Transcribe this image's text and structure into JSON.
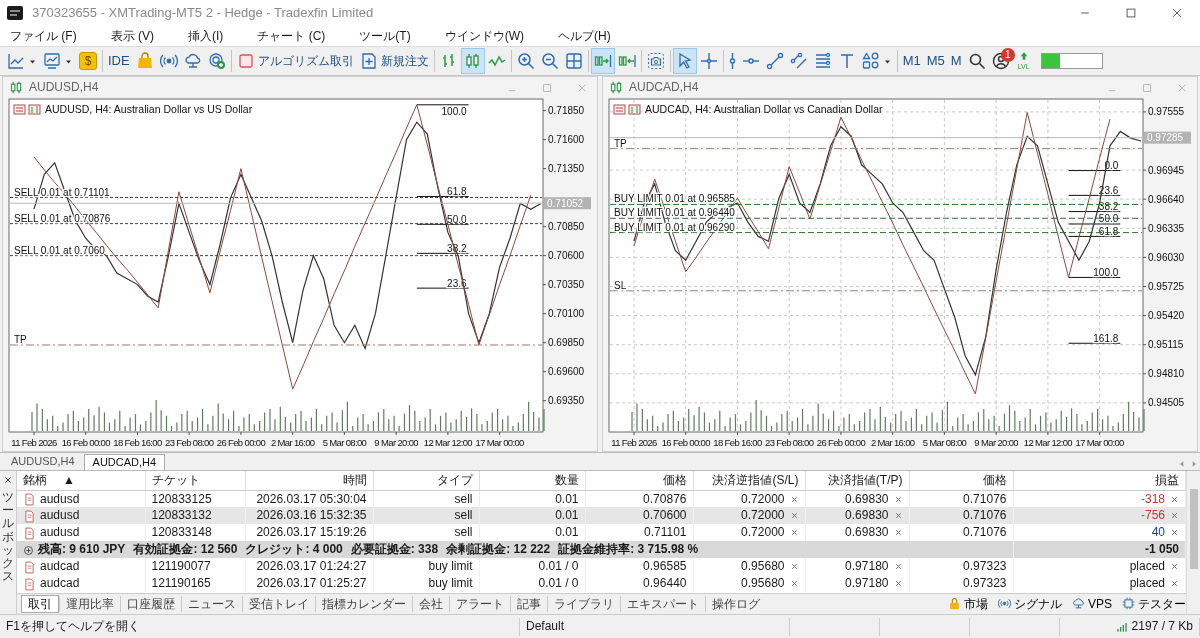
{
  "window": {
    "title": "370323655 - XMTrading-MT5 2 - Hedge - Tradexfin Limited"
  },
  "menu": [
    "ファイル (F)",
    "表示 (V)",
    "挿入(I)",
    "チャート (C)",
    "ツール(T)",
    "ウインドウ(W)",
    "ヘルプ(H)"
  ],
  "toolbar": [
    {
      "kind": "icon",
      "selected": false,
      "dropdown": true
    },
    {
      "kind": "icon",
      "selected": false,
      "dropdown": true
    },
    {
      "kind": "coin",
      "label": "$",
      "selected": false
    },
    {
      "kind": "separator"
    },
    {
      "kind": "text",
      "label": "IDE",
      "selected": false
    },
    {
      "kind": "icon",
      "selected": false
    },
    {
      "kind": "icon",
      "selected": false
    },
    {
      "kind": "icon",
      "selected": false
    },
    {
      "kind": "icon",
      "selected": false
    },
    {
      "kind": "separator"
    },
    {
      "kind": "label",
      "label": "アルゴリズム取引",
      "selected": false
    },
    {
      "kind": "label",
      "label": "新規注文",
      "selected": false
    },
    {
      "kind": "separator"
    },
    {
      "kind": "icon",
      "selected": false
    },
    {
      "kind": "icon",
      "selected": true
    },
    {
      "kind": "icon",
      "selected": false
    },
    {
      "kind": "separator"
    },
    {
      "kind": "icon",
      "selected": false
    },
    {
      "kind": "icon",
      "selected": false
    },
    {
      "kind": "icon",
      "selected": false
    },
    {
      "kind": "separator"
    },
    {
      "kind": "icon",
      "selected": true
    },
    {
      "kind": "icon",
      "selected": false
    },
    {
      "kind": "separator"
    },
    {
      "kind": "icon",
      "selected": false
    },
    {
      "kind": "separator"
    },
    {
      "kind": "icon",
      "selected": true
    },
    {
      "kind": "icon",
      "selected": false
    },
    {
      "kind": "separator"
    },
    {
      "kind": "icon",
      "selected": false
    },
    {
      "kind": "icon",
      "selected": false
    },
    {
      "kind": "icon",
      "selected": false
    },
    {
      "kind": "icon",
      "selected": false
    },
    {
      "kind": "icon",
      "selected": false
    },
    {
      "kind": "icon",
      "selected": false
    },
    {
      "kind": "icon",
      "selected": false,
      "dropdown": true
    },
    {
      "kind": "separator"
    },
    {
      "kind": "text",
      "label": "M1",
      "selected": false
    },
    {
      "kind": "text",
      "label": "M5",
      "selected": false
    },
    {
      "kind": "text",
      "label": "M",
      "selected": false
    },
    {
      "kind": "icon",
      "selected": false
    },
    {
      "kind": "account",
      "badge": "1",
      "selected": false
    },
    {
      "kind": "lvl",
      "label": "LVL",
      "selected": false
    },
    {
      "kind": "meter",
      "level": 0.3
    }
  ],
  "charts": [
    {
      "window_title": "AUDUSD,H4",
      "header": "AUDUSD, H4:  Australian Dollar vs US Dollar",
      "fibonacci_levels": [
        "100.0",
        "61.8",
        "50.0",
        "38.2",
        "23.6"
      ],
      "chart_data": {
        "type": "line",
        "grid": false,
        "ylim": [
          0.6908,
          0.7195
        ],
        "categories": [
          "11 Feb 2026",
          null,
          null,
          null,
          null,
          "16 Feb 00:00",
          null,
          null,
          null,
          null,
          "18 Feb 16:00",
          null,
          null,
          null,
          null,
          "23 Feb 08:00",
          null,
          null,
          null,
          null,
          "26 Feb 00:00",
          null,
          null,
          null,
          null,
          "2 Mar 16:00",
          null,
          null,
          null,
          null,
          "5 Mar 08:00",
          null,
          null,
          null,
          null,
          "9 Mar 20:00",
          null,
          null,
          null,
          null,
          "12 Mar 12:00",
          null,
          null,
          null,
          null,
          "17 Mar 00:00",
          null,
          null,
          null,
          null
        ],
        "series": [
          {
            "color": "#333333",
            "values": [
              0.71,
              0.713,
              0.714,
              0.7115,
              0.709,
              0.7075,
              0.7065,
              0.706,
              0.7045,
              0.704,
              0.7035,
              0.7025,
              0.702,
              0.706,
              0.7105,
              0.708,
              0.7055,
              0.7035,
              0.707,
              0.711,
              0.713,
              0.711,
              0.709,
              0.706,
              0.702,
              0.6985,
              0.703,
              0.706,
              0.704,
              0.7,
              0.6985,
              0.7,
              0.698,
              0.701,
              0.706,
              0.711,
              0.716,
              0.7175,
              0.7165,
              0.712,
              0.708,
              0.706,
              0.701,
              0.6985,
              0.701,
              0.705,
              0.7075,
              0.7105,
              0.71,
              0.7105
            ]
          },
          {
            "color": "#8b4a3c",
            "values": [
              0.7145,
              0.7134,
              0.7123,
              0.7113,
              0.7102,
              0.7091,
              0.708,
              0.7069,
              0.7058,
              0.7048,
              0.7037,
              0.7026,
              0.7015,
              0.7065,
              0.7115,
              0.7086,
              0.7057,
              0.7028,
              0.7064,
              0.7099,
              0.7135,
              0.7097,
              0.7059,
              0.7021,
              0.6983,
              0.6945,
              0.6965,
              0.6986,
              0.7006,
              0.7027,
              0.7047,
              0.7068,
              0.7088,
              0.7108,
              0.7129,
              0.7149,
              0.717,
              0.719,
              0.7156,
              0.7121,
              0.7087,
              0.7052,
              0.7018,
              0.6983,
              0.7009,
              0.7035,
              0.706,
              0.7086,
              0.7112,
              null
            ]
          }
        ],
        "yticks": [
          {
            "value": 0.7185,
            "label": "0.71850"
          },
          {
            "value": 0.716,
            "label": "0.71600"
          },
          {
            "value": 0.7135,
            "label": "0.71350"
          },
          {
            "value": 0.7085,
            "label": "0.70850"
          },
          {
            "value": 0.706,
            "label": "0.70600"
          },
          {
            "value": 0.7035,
            "label": "0.70350"
          },
          {
            "value": 0.701,
            "label": "0.70100"
          },
          {
            "value": 0.6985,
            "label": "0.69850"
          },
          {
            "value": 0.696,
            "label": "0.69600"
          },
          {
            "value": 0.6935,
            "label": "0.69350"
          }
        ],
        "ref_lines": [
          {
            "axis": "y",
            "value": 0.71101,
            "label": "SELL 0.01 at 0.71101",
            "color": "#444444"
          },
          {
            "axis": "y",
            "value": 0.70876,
            "label": "SELL 0.01 at 0.70876",
            "color": "#444444"
          },
          {
            "axis": "y",
            "value": 0.706,
            "label": "SELL 0.01 at 0.7060",
            "color": "#444444"
          },
          {
            "axis": "y",
            "value": 0.6983,
            "label": "TP",
            "color": "#a57a68"
          },
          {
            "axis": "y",
            "value": 0.71052,
            "label": "0.71052",
            "color": "#b8b8b8"
          }
        ]
      }
    },
    {
      "window_title": "AUDCAD,H4",
      "header": "AUDCAD, H4:  Australian Dollar vs Canadian Dollar",
      "fibonacci_levels": [
        "0.0",
        "23.6",
        "38.2",
        "50.0",
        "61.8",
        "100.0",
        "161.8"
      ],
      "chart_data": {
        "type": "line",
        "grid": true,
        "ylim": [
          0.942,
          0.9769
        ],
        "categories": [
          "11 Feb 2026",
          null,
          null,
          null,
          null,
          "16 Feb 00:00",
          null,
          null,
          null,
          null,
          "18 Feb 16:00",
          null,
          null,
          null,
          null,
          "23 Feb 08:00",
          null,
          null,
          null,
          null,
          "26 Feb 00:00",
          null,
          null,
          null,
          null,
          "2 Mar 16:00",
          null,
          null,
          null,
          null,
          "5 Mar 08:00",
          null,
          null,
          null,
          null,
          "9 Mar 20:00",
          null,
          null,
          null,
          null,
          "12 Mar 12:00",
          null,
          null,
          null,
          null,
          "17 Mar 00:00",
          null,
          null,
          null,
          null
        ],
        "series": [
          {
            "color": "#333333",
            "values": [
              0.962,
              0.966,
              0.968,
              0.964,
              0.961,
              0.96,
              0.962,
              0.964,
              0.965,
              0.9655,
              0.966,
              0.964,
              0.9625,
              0.962,
              0.9665,
              0.969,
              0.966,
              0.965,
              0.968,
              0.972,
              0.974,
              0.973,
              0.97,
              0.969,
              0.968,
              0.966,
              0.965,
              0.963,
              0.961,
              0.96,
              0.957,
              0.954,
              0.95,
              0.948,
              0.952,
              0.959,
              0.965,
              0.97,
              0.973,
              0.972,
              0.968,
              0.964,
              0.962,
              0.96,
              0.962,
              0.966,
              0.972,
              0.9735,
              0.9728,
              0.9725
            ]
          },
          {
            "color": "#8b4a3c",
            "values": [
              0.9615,
              0.965,
              0.9685,
              0.9653,
              0.962,
              0.9588,
              0.9603,
              0.9619,
              0.9634,
              0.965,
              0.9665,
              0.9647,
              0.963,
              0.9612,
              0.9655,
              0.9698,
              0.9671,
              0.9643,
              0.9679,
              0.9714,
              0.975,
              0.9728,
              0.9705,
              0.9683,
              0.9661,
              0.9639,
              0.9616,
              0.9594,
              0.9572,
              0.9549,
              0.9527,
              0.9505,
              0.9482,
              0.946,
              0.9519,
              0.9578,
              0.9637,
              0.9696,
              0.9755,
              0.9712,
              0.9669,
              0.9625,
              0.9582,
              0.9624,
              0.9665,
              0.9707,
              0.9748,
              null,
              null,
              null
            ]
          }
        ],
        "yticks": [
          {
            "value": 0.97555,
            "label": "0.97555"
          },
          {
            "value": 0.96945,
            "label": "0.96945"
          },
          {
            "value": 0.9664,
            "label": "0.96640"
          },
          {
            "value": 0.96335,
            "label": "0.96335"
          },
          {
            "value": 0.9603,
            "label": "0.96030"
          },
          {
            "value": 0.95725,
            "label": "0.95725"
          },
          {
            "value": 0.9542,
            "label": "0.95420"
          },
          {
            "value": 0.95115,
            "label": "0.95115"
          },
          {
            "value": 0.9481,
            "label": "0.94810"
          },
          {
            "value": 0.94505,
            "label": "0.94505"
          }
        ],
        "ref_lines": [
          {
            "axis": "y",
            "value": 0.9717,
            "label": "TP",
            "color": "#a57a68"
          },
          {
            "axis": "y",
            "value": 0.96585,
            "label": "BUY LIMIT 0.01 at 0.96585",
            "color": "#2f6f2f"
          },
          {
            "axis": "y",
            "value": 0.9644,
            "label": "BUY LIMIT 0.01 at 0.96440",
            "color": "#2f6f2f"
          },
          {
            "axis": "y",
            "value": 0.9629,
            "label": "BUY LIMIT 0.01 at 0.96290",
            "color": "#2f6f2f"
          },
          {
            "axis": "y",
            "value": 0.9568,
            "label": "SL",
            "color": "#a57a68"
          },
          {
            "axis": "y",
            "value": 0.97285,
            "label": "0.97285",
            "color": "#b8b8b8"
          }
        ]
      }
    }
  ],
  "chart_tabs": [
    {
      "label": "AUDUSD,H4",
      "selected": false
    },
    {
      "label": "AUDCAD,H4",
      "selected": true
    }
  ],
  "toolbox": {
    "title": "ツールボックス",
    "columns": [
      {
        "label": "銘柄",
        "sort": "▲"
      },
      {
        "label": "チケット"
      },
      {
        "label": "時間"
      },
      {
        "label": "タイプ"
      },
      {
        "label": "数量"
      },
      {
        "label": "価格"
      },
      {
        "label": "決済逆指値(S/L)"
      },
      {
        "label": "決済指値(T/P)"
      },
      {
        "label": "価格"
      },
      {
        "label": "損益"
      }
    ],
    "positions": [
      {
        "symbol": "audusd",
        "ticket": "120833125",
        "time": "2026.03.17 05:30:04",
        "type": "sell",
        "volume": "0.01",
        "price": "0.70876",
        "sl": "0.72000",
        "tp": "0.69830",
        "current": "0.71076",
        "profit": "-318",
        "color": "#c0392b",
        "selected": false
      },
      {
        "symbol": "audusd",
        "ticket": "120833132",
        "time": "2026.03.16 15:32:35",
        "type": "sell",
        "volume": "0.01",
        "price": "0.70600",
        "sl": "0.72000",
        "tp": "0.69830",
        "current": "0.71076",
        "profit": "-756",
        "color": "#c0392b",
        "selected": true
      },
      {
        "symbol": "audusd",
        "ticket": "120833148",
        "time": "2026.03.17 15:19:26",
        "type": "sell",
        "volume": "0.01",
        "price": "0.71101",
        "sl": "0.72000",
        "tp": "0.69830",
        "current": "0.71076",
        "profit": "40",
        "color": "#1f3fa0",
        "selected": false
      }
    ],
    "summary": [
      "残高: 9 610 JPY",
      "有効証拠金: 12 560",
      "クレジット: 4 000",
      "必要証拠金: 338",
      "余剰証拠金: 12 222",
      "証拠金維持率: 3 715.98 %"
    ],
    "summary_total": "-1 050",
    "orders": [
      {
        "symbol": "audcad",
        "ticket": "121190077",
        "time": "2026.03.17 01:24:27",
        "type": "buy limit",
        "volume": "0.01 / 0",
        "price": "0.96585",
        "sl": "0.95680",
        "tp": "0.97180",
        "current": "0.97323",
        "status": "placed"
      },
      {
        "symbol": "audcad",
        "ticket": "121190165",
        "time": "2026.03.17 01:25:27",
        "type": "buy limit",
        "volume": "0.01 / 0",
        "price": "0.96440",
        "sl": "0.95680",
        "tp": "0.97180",
        "current": "0.97323",
        "status": "placed"
      }
    ],
    "tabs": [
      {
        "label": "取引",
        "selected": true
      },
      {
        "label": "運用比率",
        "selected": false
      },
      {
        "label": "口座履歴",
        "selected": false
      },
      {
        "label": "ニュース",
        "selected": false
      },
      {
        "label": "受信トレイ",
        "selected": false
      },
      {
        "label": "指標カレンダー",
        "selected": false
      },
      {
        "label": "会社",
        "selected": false
      },
      {
        "label": "アラート",
        "selected": false
      },
      {
        "label": "記事",
        "selected": false
      },
      {
        "label": "ライブラリ",
        "selected": false
      },
      {
        "label": "エキスパート",
        "selected": false
      },
      {
        "label": "操作ログ",
        "selected": false
      }
    ],
    "links": [
      "市場",
      "シグナル",
      "VPS",
      "テスター"
    ]
  },
  "status_bar": {
    "help": "F1を押してヘルプを開く",
    "profile": "Default",
    "traffic": "2197 / 7 Kb"
  }
}
